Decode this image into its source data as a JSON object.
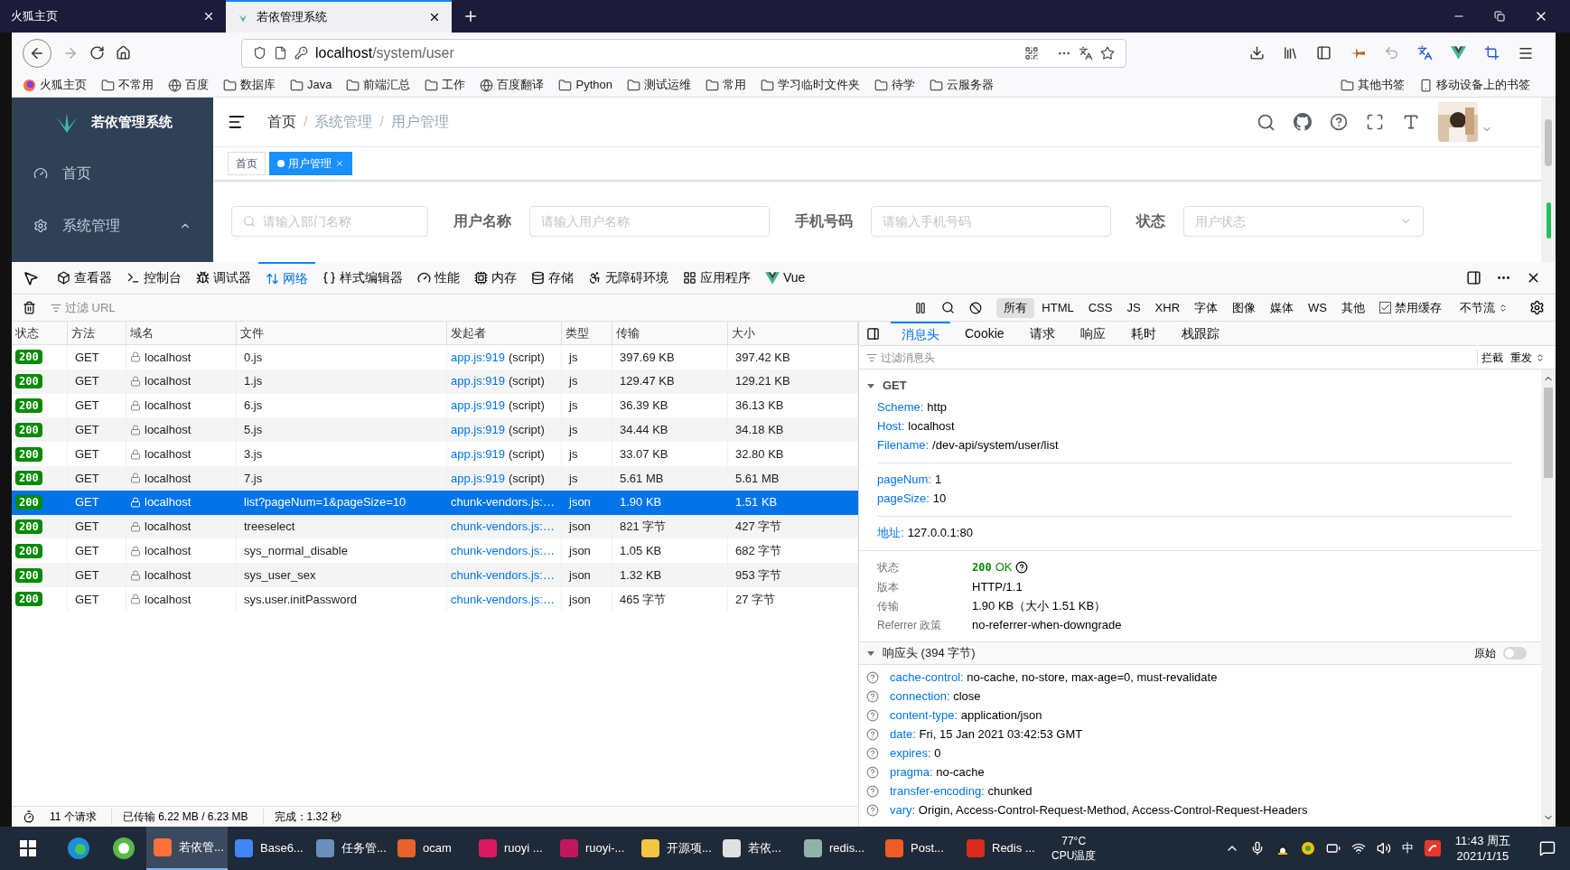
{
  "browser": {
    "tabs": [
      {
        "title": "火狐主页",
        "selected": false
      },
      {
        "title": "若依管理系统",
        "selected": true
      }
    ],
    "address": {
      "host": "localhost",
      "path": "/system/user"
    },
    "bookmarks": [
      {
        "label": "火狐主页",
        "kind": "firefox"
      },
      {
        "label": "不常用",
        "kind": "folder"
      },
      {
        "label": "百度",
        "kind": "globe"
      },
      {
        "label": "数据库",
        "kind": "folder"
      },
      {
        "label": "Java",
        "kind": "folder"
      },
      {
        "label": "前端汇总",
        "kind": "folder"
      },
      {
        "label": "工作",
        "kind": "folder"
      },
      {
        "label": "百度翻译",
        "kind": "globe"
      },
      {
        "label": "Python",
        "kind": "folder"
      },
      {
        "label": "测试运维",
        "kind": "folder"
      },
      {
        "label": "常用",
        "kind": "folder"
      },
      {
        "label": "学习临时文件夹",
        "kind": "folder"
      },
      {
        "label": "待学",
        "kind": "folder"
      },
      {
        "label": "云服务器",
        "kind": "folder"
      }
    ],
    "bookmarks_right": [
      {
        "label": "其他书签",
        "kind": "folder"
      },
      {
        "label": "移动设备上的书签",
        "kind": "mobile"
      }
    ]
  },
  "app": {
    "logo_title": "若依管理系统",
    "sidebar": [
      {
        "label": "首页",
        "kind": "link"
      },
      {
        "label": "系统管理",
        "kind": "group",
        "expanded": true
      }
    ],
    "breadcrumb": [
      "首页",
      "系统管理",
      "用户管理"
    ],
    "breadcrumb_separator": "/",
    "tags": [
      {
        "label": "首页",
        "selected": false
      },
      {
        "label": "用户管理",
        "selected": true
      }
    ],
    "filters": [
      {
        "kind": "search",
        "placeholder": "请输入部门名称"
      },
      {
        "kind": "text",
        "label": "用户名称",
        "placeholder": "请输入用户名称"
      },
      {
        "kind": "text",
        "label": "手机号码",
        "placeholder": "请输入手机号码"
      },
      {
        "kind": "select",
        "label": "状态",
        "placeholder": "用户状态"
      }
    ]
  },
  "devtools": {
    "tools": [
      {
        "label": "查看器",
        "kind": "inspector",
        "selected": false
      },
      {
        "label": "控制台",
        "kind": "console",
        "selected": false
      },
      {
        "label": "调试器",
        "kind": "debugger",
        "selected": false
      },
      {
        "label": "网络",
        "kind": "network",
        "selected": true
      },
      {
        "label": "样式编辑器",
        "kind": "style",
        "selected": false
      },
      {
        "label": "性能",
        "kind": "performance",
        "selected": false
      },
      {
        "label": "内存",
        "kind": "memory",
        "selected": false
      },
      {
        "label": "存储",
        "kind": "storage",
        "selected": false
      },
      {
        "label": "无障碍环境",
        "kind": "accessibility",
        "selected": false
      },
      {
        "label": "应用程序",
        "kind": "application",
        "selected": false
      },
      {
        "label": "Vue",
        "kind": "vue",
        "selected": false
      }
    ],
    "url_filter": {
      "placeholder": "过滤 URL"
    },
    "type_filters": [
      {
        "label": "所有",
        "selected": true
      },
      {
        "label": "HTML",
        "selected": false
      },
      {
        "label": "CSS",
        "selected": false
      },
      {
        "label": "JS",
        "selected": false
      },
      {
        "label": "XHR",
        "selected": false
      },
      {
        "label": "字体",
        "selected": false
      },
      {
        "label": "图像",
        "selected": false
      },
      {
        "label": "媒体",
        "selected": false
      },
      {
        "label": "WS",
        "selected": false
      },
      {
        "label": "其他",
        "selected": false
      }
    ],
    "disable_cache": {
      "label": "禁用缓存",
      "checked": true
    },
    "throttling": "不节流",
    "table": {
      "columns": [
        "状态",
        "方法",
        "域名",
        "文件",
        "发起者",
        "类型",
        "传输",
        "大小"
      ],
      "rows": [
        {
          "status": "200",
          "method": "GET",
          "domain": "localhost",
          "file": "0.js",
          "initiator": "app.js:919",
          "initiator_note": "(script)",
          "type": "js",
          "transferred": "397.69 KB",
          "size": "397.42 KB",
          "selected": false
        },
        {
          "status": "200",
          "method": "GET",
          "domain": "localhost",
          "file": "1.js",
          "initiator": "app.js:919",
          "initiator_note": "(script)",
          "type": "js",
          "transferred": "129.47 KB",
          "size": "129.21 KB",
          "selected": false
        },
        {
          "status": "200",
          "method": "GET",
          "domain": "localhost",
          "file": "6.js",
          "initiator": "app.js:919",
          "initiator_note": "(script)",
          "type": "js",
          "transferred": "36.39 KB",
          "size": "36.13 KB",
          "selected": false
        },
        {
          "status": "200",
          "method": "GET",
          "domain": "localhost",
          "file": "5.js",
          "initiator": "app.js:919",
          "initiator_note": "(script)",
          "type": "js",
          "transferred": "34.44 KB",
          "size": "34.18 KB",
          "selected": false
        },
        {
          "status": "200",
          "method": "GET",
          "domain": "localhost",
          "file": "3.js",
          "initiator": "app.js:919",
          "initiator_note": "(script)",
          "type": "js",
          "transferred": "33.07 KB",
          "size": "32.80 KB",
          "selected": false
        },
        {
          "status": "200",
          "method": "GET",
          "domain": "localhost",
          "file": "7.js",
          "initiator": "app.js:919",
          "initiator_note": "(script)",
          "type": "js",
          "transferred": "5.61 MB",
          "size": "5.61 MB",
          "selected": false
        },
        {
          "status": "200",
          "method": "GET",
          "domain": "localhost",
          "file": "list?pageNum=1&pageSize=10",
          "initiator": "chunk-vendors.js:…",
          "type": "json",
          "transferred": "1.90 KB",
          "size": "1.51 KB",
          "selected": true
        },
        {
          "status": "200",
          "method": "GET",
          "domain": "localhost",
          "file": "treeselect",
          "initiator": "chunk-vendors.js:…",
          "type": "json",
          "transferred": "821 字节",
          "size": "427 字节",
          "selected": false
        },
        {
          "status": "200",
          "method": "GET",
          "domain": "localhost",
          "file": "sys_normal_disable",
          "initiator": "chunk-vendors.js:…",
          "type": "json",
          "transferred": "1.05 KB",
          "size": "682 字节",
          "selected": false
        },
        {
          "status": "200",
          "method": "GET",
          "domain": "localhost",
          "file": "sys_user_sex",
          "initiator": "chunk-vendors.js:…",
          "type": "json",
          "transferred": "1.32 KB",
          "size": "953 字节",
          "selected": false
        },
        {
          "status": "200",
          "method": "GET",
          "domain": "localhost",
          "file": "sys.user.initPassword",
          "initiator": "chunk-vendors.js:…",
          "type": "json",
          "transferred": "465 字节",
          "size": "27 字节",
          "selected": false
        }
      ]
    },
    "status_bar": {
      "requests": "11 个请求",
      "transferred": "已传输 6.22 MB / 6.23 MB",
      "finished": "完成：1.32 秒"
    },
    "details": {
      "tabs": [
        {
          "label": "消息头",
          "selected": true
        },
        {
          "label": "Cookie",
          "selected": false
        },
        {
          "label": "请求",
          "selected": false
        },
        {
          "label": "响应",
          "selected": false
        },
        {
          "label": "耗时",
          "selected": false
        },
        {
          "label": "栈跟踪",
          "selected": false
        }
      ],
      "filter_placeholder": "过滤消息头",
      "block_label": "拦截",
      "resend_label": "重发",
      "request": {
        "title": "GET",
        "expanded": true,
        "url_fields": [
          {
            "key": "Scheme:",
            "value": "http"
          },
          {
            "key": "Host:",
            "value": "localhost"
          },
          {
            "key": "Filename:",
            "value": "/dev-api/system/user/list"
          }
        ],
        "params": [
          {
            "key": "pageNum:",
            "value": "1"
          },
          {
            "key": "pageSize:",
            "value": "10"
          }
        ],
        "address": {
          "key": "地址:",
          "value": "127.0.0.1:80"
        }
      },
      "summary": {
        "status_label": "状态",
        "status_code": "200",
        "status_text": "OK",
        "rows": [
          {
            "key": "版本",
            "value": "HTTP/1.1"
          },
          {
            "key": "传输",
            "value": "1.90 KB（大小 1.51 KB）"
          },
          {
            "key": "Referrer 政策",
            "value": "no-referrer-when-downgrade"
          }
        ]
      },
      "response_headers": {
        "title": "响应头 (394 字节)",
        "expanded": true,
        "raw_label": "原始",
        "raw_on": false,
        "headers": [
          {
            "key": "cache-control:",
            "value": "no-cache, no-store, max-age=0, must-revalidate"
          },
          {
            "key": "connection:",
            "value": "close"
          },
          {
            "key": "content-type:",
            "value": "application/json"
          },
          {
            "key": "date:",
            "value": "Fri, 15 Jan 2021 03:42:53 GMT"
          },
          {
            "key": "expires:",
            "value": "0"
          },
          {
            "key": "pragma:",
            "value": "no-cache"
          },
          {
            "key": "transfer-encoding:",
            "value": "chunked"
          },
          {
            "key": "vary:",
            "value": "Origin, Access-Control-Request-Method, Access-Control-Request-Headers"
          }
        ]
      }
    }
  },
  "taskbar": {
    "apps": [
      {
        "label": "若依管...",
        "color": "#ff7139",
        "selected": true
      },
      {
        "label": "Base6...",
        "color": "#4285f4",
        "selected": false
      },
      {
        "label": "任务管...",
        "color": "#6a8fb8",
        "selected": false
      },
      {
        "label": "ocam",
        "color": "#e8612c",
        "selected": false
      },
      {
        "label": "ruoyi ...",
        "color": "#d81b60",
        "selected": false
      },
      {
        "label": "ruoyi-...",
        "color": "#c2185b",
        "selected": false
      },
      {
        "label": "开源项...",
        "color": "#f4c542",
        "selected": false
      },
      {
        "label": "若依...",
        "color": "#e0e0e0",
        "selected": false
      },
      {
        "label": "redis...",
        "color": "#8fb3a8",
        "selected": false
      },
      {
        "label": "Post...",
        "color": "#ef5b25",
        "selected": false
      },
      {
        "label": "Redis ...",
        "color": "#d82c20",
        "selected": false
      }
    ],
    "temperature": "77°C",
    "temperature_label": "CPU温度",
    "ime": "中",
    "time": "11:43 周五",
    "date": "2021/1/15"
  }
}
